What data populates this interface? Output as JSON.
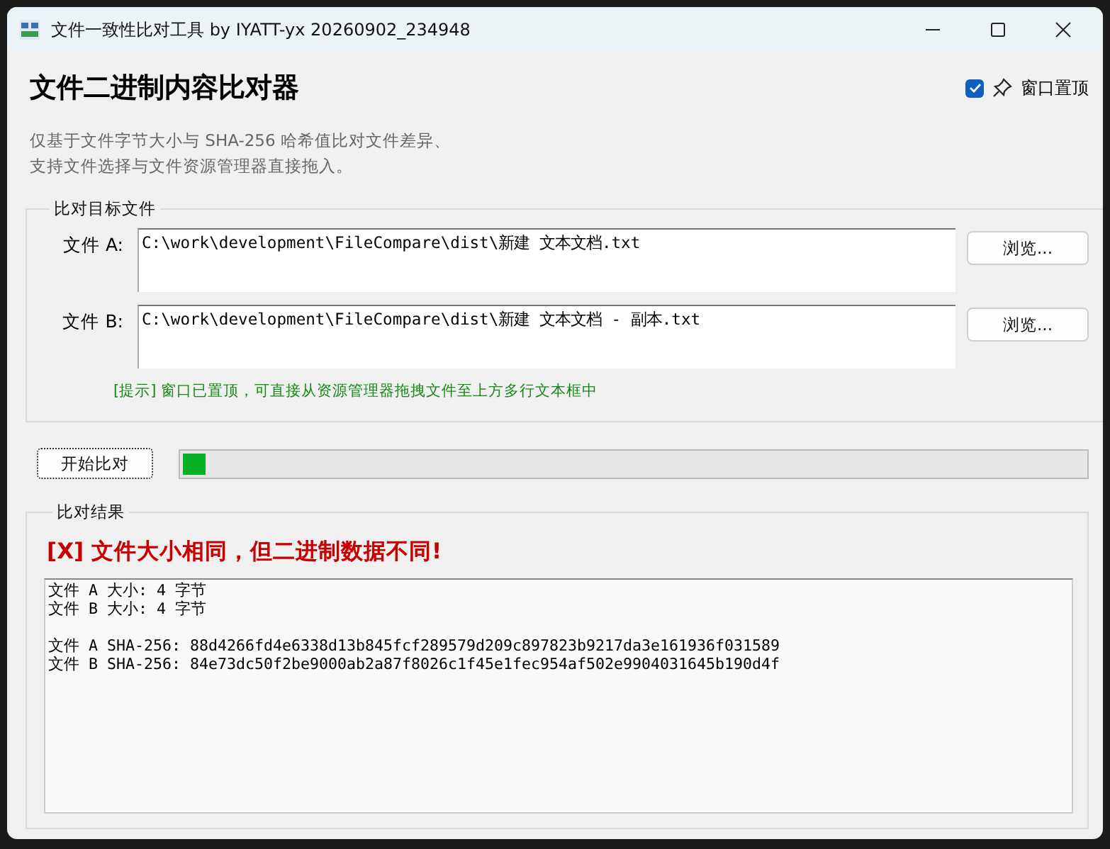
{
  "window": {
    "title": "文件一致性比对工具 by IYATT-yx 20260902_234948"
  },
  "header": {
    "title": "文件二进制内容比对器",
    "pin": {
      "label": "窗口置顶",
      "checked": true
    },
    "description": [
      "仅基于文件字节大小与 SHA-256 哈希值比对文件差异、",
      "支持文件选择与文件资源管理器直接拖入。"
    ]
  },
  "targets": {
    "title": "比对目标文件",
    "files": [
      {
        "label": "文件 A:",
        "value": "C:\\work\\development\\FileCompare\\dist\\新建 文本文档.txt",
        "button": "浏览..."
      },
      {
        "label": "文件 B:",
        "value": "C:\\work\\development\\FileCompare\\dist\\新建 文本文档 - 副本.txt",
        "button": "浏览..."
      }
    ],
    "hint": "[提示] 窗口已置顶，可直接从资源管理器拖拽文件至上方多行文本框中"
  },
  "start_button": "开始比对",
  "progress": {
    "level": 0.025
  },
  "results": {
    "title": "比对结果",
    "verdict": "[X] 文件大小相同，但二进制数据不同!",
    "blocks": [
      [
        "文件 A 大小: 4 字节",
        "文件 B 大小: 4 字节"
      ],
      [
        "文件 A SHA-256: 88d4266fd4e6338d13b845fcf289579d209c897823b9217da3e161936f031589",
        "文件 B SHA-256: 84e73dc50f2be9000ab2a87f8026c1f45e1fec954af502e9904031645b190d4f"
      ]
    ]
  }
}
